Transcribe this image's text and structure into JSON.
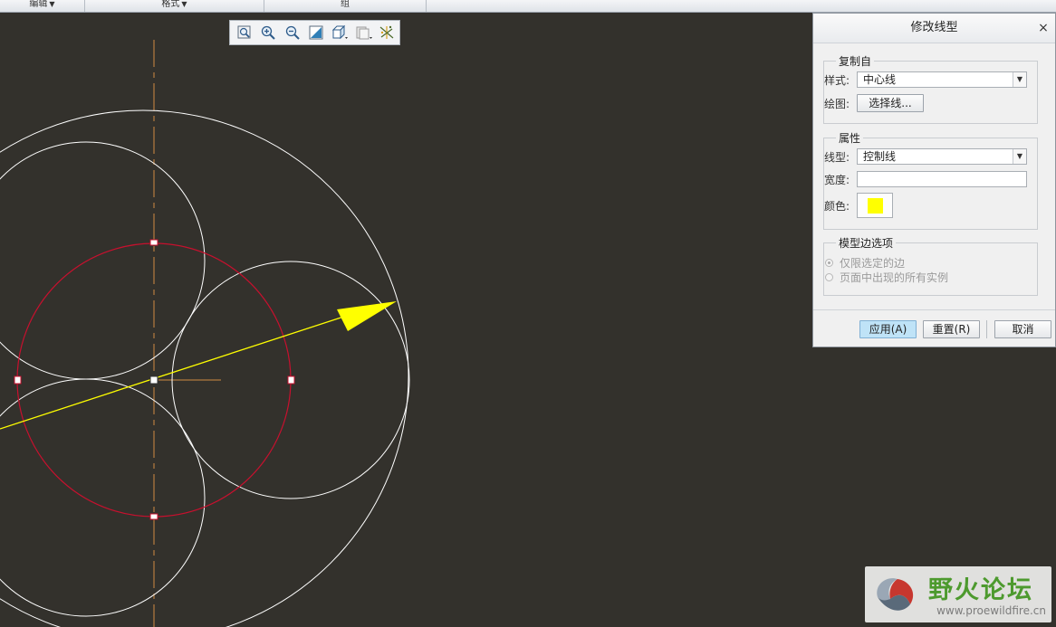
{
  "ribbon": {
    "groups": [
      {
        "label": "编辑",
        "dropdown": true
      },
      {
        "label": "格式",
        "dropdown": true
      },
      {
        "label": "组",
        "dropdown": false
      }
    ]
  },
  "view_toolbar": {
    "tools": [
      "refit-icon",
      "zoom-in-icon",
      "zoom-out-icon",
      "repaint-icon",
      "display-style-icon",
      "layers-icon",
      "annotation-display-icon"
    ]
  },
  "dialog": {
    "title": "修改线型",
    "close": "×",
    "copy_from": {
      "legend": "复制自",
      "style_label": "样式:",
      "style_value": "中心线",
      "draw_label": "绘图:",
      "select_line_button": "选择线..."
    },
    "properties": {
      "legend": "属性",
      "linetype_label": "线型:",
      "linetype_value": "控制线",
      "width_label": "宽度:",
      "width_value": "",
      "color_label": "颜色:",
      "color_value": "#ffff00"
    },
    "model_edge": {
      "legend": "模型边选项",
      "options": [
        {
          "label": "仅限选定的边",
          "selected": true,
          "enabled": false
        },
        {
          "label": "页面中出现的所有实例",
          "selected": false,
          "enabled": false
        }
      ]
    },
    "buttons": {
      "apply": "应用(A)",
      "reset": "重置(R)",
      "cancel": "取消"
    }
  },
  "colors": {
    "canvas_bg": "#33312c",
    "circle": "#ffffff",
    "selected_circle": "#c8102e",
    "centerline": "#d28a42",
    "arrow": "#ffff00",
    "apply_highlight": "#bfe3f7"
  },
  "watermark": {
    "title": "野火论坛",
    "url": "www.proewildfire.cn"
  }
}
